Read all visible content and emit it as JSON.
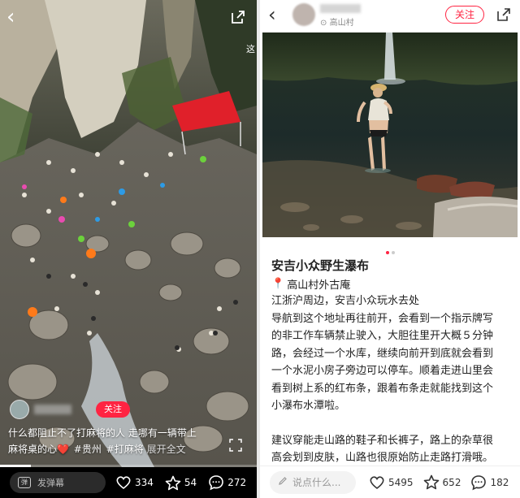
{
  "left_post": {
    "side_hint": "这",
    "follow_label": "关注",
    "caption": {
      "line1": "什么都阻止不了打麻将的人 走哪有一辆带上",
      "line2": "麻将桌的心",
      "heart": "❤️",
      "tags": [
        "#贵州",
        "#打麻将"
      ],
      "more": "展开全文"
    },
    "progress": 0.12,
    "danmu_placeholder": "发弹幕",
    "danmu_icon": "弹",
    "stats": {
      "likes": "334",
      "collects": "54",
      "comments": "272"
    }
  },
  "right_post": {
    "location_label": "高山村",
    "follow_label": "关注",
    "image_count": 2,
    "active_image": 1,
    "title": "安吉小众野生瀑布",
    "place_pin": "📍",
    "place": "高山村外古庵",
    "body": [
      "江浙沪周边，安吉小众玩水去处",
      "导航到这个地址再往前开，会看到一个指示牌写",
      "的非工作车辆禁止驶入，大胆往里开大概５分钟",
      "路，会经过一个水库，继续向前开到底就会看到",
      "一个水泥小房子旁边可以停车。顺着走进山里会",
      "看到树上系的红布条，跟着布条走就能找到这个",
      "小瀑布水潭啦。",
      "",
      "建议穿能走山路的鞋子和长裤子，路上的杂草很",
      "高会划到皮肤，山路也很原始防止走路打滑哦。"
    ],
    "comment_placeholder": "说点什么...",
    "stats": {
      "likes": "5495",
      "collects": "652",
      "comments": "182"
    }
  },
  "colors": {
    "accent": "#ff2442",
    "dark_bg": "#000000",
    "light_bg": "#ffffff"
  }
}
